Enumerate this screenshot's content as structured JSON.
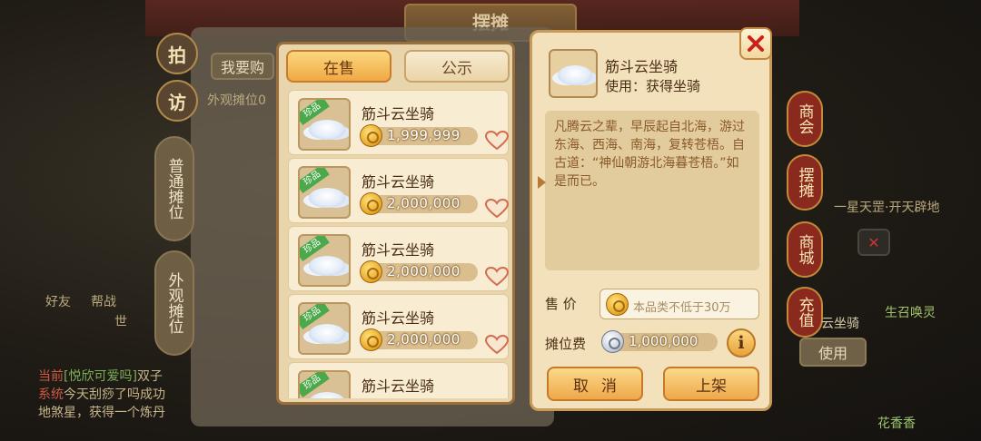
{
  "background": {
    "window_title": "摆摊",
    "top_tab_partial": "我要购",
    "filter_partial": "外观摊位0",
    "left_circle_1": "拍",
    "left_circle_2": "访",
    "left_vtab_1": "普通摊位",
    "left_vtab_2": "外观摊位",
    "right_tabs": [
      "商会",
      "摆摊",
      "商城",
      "充值"
    ],
    "right_item_name": "云坐骑",
    "right_use_button": "使用",
    "right_caption_1": "一星天罡·开天辟地",
    "right_caption_2": "生召唤灵",
    "right_caption_3": "花香香",
    "left_icon_labels": [
      "好友",
      "帮战"
    ],
    "world_label": "世",
    "chat_lines": [
      {
        "prefix": "当前",
        "name": "[悦欣可爱吗]",
        "text": "双子"
      },
      {
        "prefix": "系统",
        "name": "",
        "text": "今天刮痧了吗成功"
      },
      {
        "prefix": "",
        "name": "",
        "text": "地煞星，获得一个炼丹"
      }
    ]
  },
  "list_panel": {
    "tabs": [
      {
        "label": "在售",
        "active": true
      },
      {
        "label": "公示",
        "active": false
      }
    ],
    "items": [
      {
        "badge": "珍品",
        "name": "筋斗云坐骑",
        "price": "1,999,999"
      },
      {
        "badge": "珍品",
        "name": "筋斗云坐骑",
        "price": "2,000,000"
      },
      {
        "badge": "珍品",
        "name": "筋斗云坐骑",
        "price": "2,000,000"
      },
      {
        "badge": "珍品",
        "name": "筋斗云坐骑",
        "price": "2,000,000"
      },
      {
        "badge": "珍品",
        "name": "筋斗云坐骑",
        "price": ""
      }
    ]
  },
  "detail": {
    "name": "筋斗云坐骑",
    "use": "使用：获得坐骑",
    "description": "凡腾云之辈，早辰起自北海，游过东海、西海、南海，复转苍梧。自古道：“神仙朝游北海暮苍梧。”如是而已。",
    "sale_label": "售 价",
    "sale_placeholder": "本品类不低于30万",
    "fee_label": "摊位费",
    "fee_value": "1,000,000",
    "info_label": "i",
    "cancel_label": "取消",
    "list_label": "上架"
  },
  "colors": {
    "accent_gold": "#f0a944",
    "panel_bg": "#e9d5ab",
    "badge_green": "#4ba84b",
    "close_red": "#c8231a"
  },
  "icons": {
    "close": "close-icon",
    "heart": "heart-icon",
    "coin": "gold-coin-icon",
    "silver": "silver-coin-icon",
    "item": "cloud-mount-icon"
  }
}
